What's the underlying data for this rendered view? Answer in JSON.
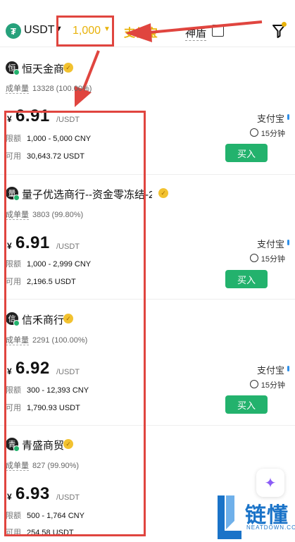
{
  "header": {
    "coin_symbol": "₮",
    "coin": "USDT",
    "amount": "1,000",
    "payment_filter": "支付宝",
    "shield_label": "神盾",
    "accent_color": "#e8b20a"
  },
  "merchants": [
    {
      "avatar_char": "恒",
      "name": "恒天金商",
      "orders_label": "成单量",
      "orders": "13328 (100.00%)",
      "currency": "¥",
      "price": "6.91",
      "unit": "/USDT",
      "limit_label": "限额",
      "limit": "1,000 - 5,000 CNY",
      "available_label": "可用",
      "available": "30,643.72 USDT",
      "payment": "支付宝",
      "time": "15分钟",
      "buy_label": "买入"
    },
    {
      "avatar_char": "量",
      "name": "量子优选商行--资金零冻结-2...",
      "orders_label": "成单量",
      "orders": "3803 (99.80%)",
      "currency": "¥",
      "price": "6.91",
      "unit": "/USDT",
      "limit_label": "限额",
      "limit": "1,000 - 2,999 CNY",
      "available_label": "可用",
      "available": "2,196.5 USDT",
      "payment": "支付宝",
      "time": "15分钟",
      "buy_label": "买入"
    },
    {
      "avatar_char": "信",
      "name": "信禾商行",
      "orders_label": "成单量",
      "orders": "2291 (100.00%)",
      "currency": "¥",
      "price": "6.92",
      "unit": "/USDT",
      "limit_label": "限额",
      "limit": "300 - 12,393 CNY",
      "available_label": "可用",
      "available": "1,790.93 USDT",
      "payment": "支付宝",
      "time": "15分钟",
      "buy_label": "买入"
    },
    {
      "avatar_char": "青",
      "name": "青盛商贸",
      "orders_label": "成单量",
      "orders": "827 (99.90%)",
      "currency": "¥",
      "price": "6.93",
      "unit": "/USDT",
      "limit_label": "限额",
      "limit": "500 - 1,764 CNY",
      "available_label": "可用",
      "available": "254.58 USDT"
    }
  ],
  "watermark": {
    "text": "链懂",
    "sub": "NEATDOWN.COM"
  },
  "colors": {
    "buy": "#23b26d",
    "annotation": "#e0453f",
    "watermark": "#1a73c8"
  }
}
